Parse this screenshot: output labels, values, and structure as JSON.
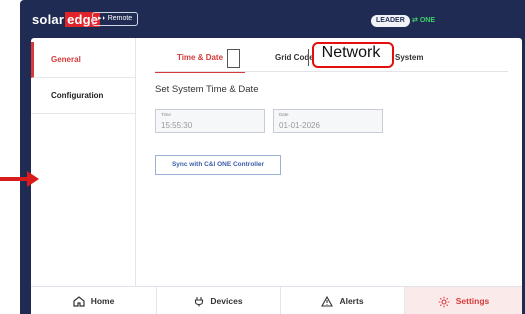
{
  "header": {
    "logo_solar": "solar",
    "logo_edge": "edge",
    "remote_label": "Remote",
    "leader_badge": "LEADER",
    "one_status": "ONE"
  },
  "sidebar": {
    "items": [
      {
        "label": "General",
        "active": true
      },
      {
        "label": "Configuration",
        "active": false
      }
    ]
  },
  "tabs": {
    "time_date": "Time & Date",
    "grid_code": "Grid Code",
    "network": "Network",
    "system": "System",
    "active": "time_date"
  },
  "content": {
    "section_title": "Set System Time & Date",
    "time": {
      "label": "Time",
      "value": "15:55:30"
    },
    "date": {
      "label": "Date",
      "value": "01-01-2026"
    },
    "sync_button": "Sync with C&I ONE Controller"
  },
  "navbar": {
    "home": "Home",
    "devices": "Devices",
    "alerts": "Alerts",
    "settings": "Settings",
    "active": "settings"
  },
  "colors": {
    "frame": "#1f2b52",
    "accent_red": "#d63a3a",
    "highlight_box": "#e30f0f",
    "one_green": "#3fd16b",
    "arrow": "#d81b1b"
  }
}
